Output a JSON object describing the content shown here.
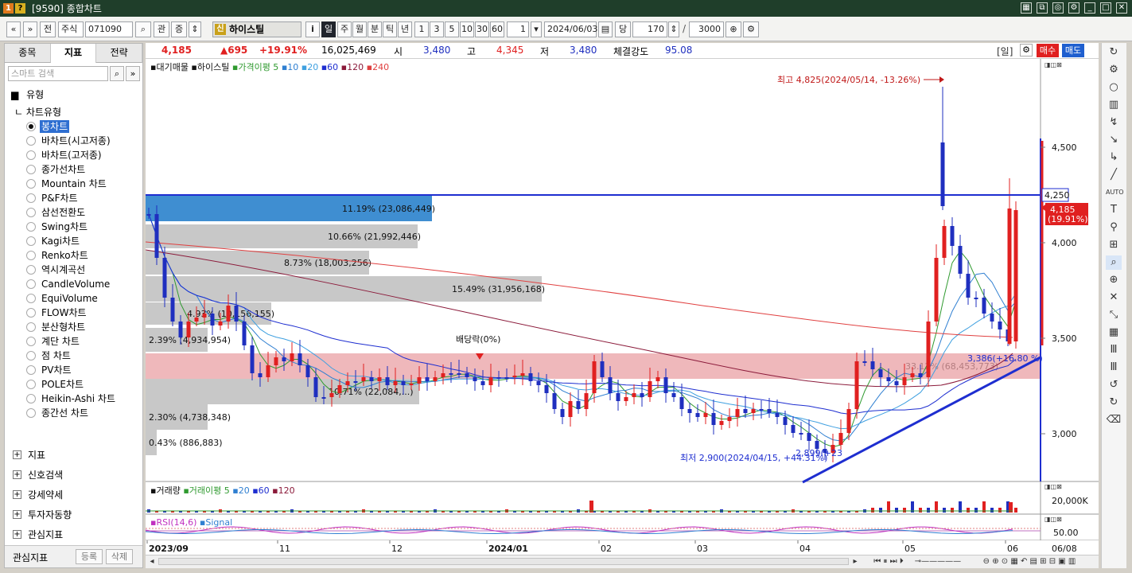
{
  "window": {
    "title": "[9590] 종합차트"
  },
  "toolbar": {
    "nav_prev": "«",
    "nav_down": "»",
    "btn_all": "전",
    "market": "주식",
    "code": "071090",
    "btn_relation": "관",
    "btn_updown": "증",
    "stock_badge": "신",
    "stock_name": "하이스틸",
    "info": "i",
    "periods": [
      "일",
      "주",
      "월",
      "분",
      "틱",
      "년"
    ],
    "active_period": "일",
    "intervals": [
      "1",
      "3",
      "5",
      "10",
      "30",
      "60"
    ],
    "interval_value": "1",
    "date": "2024/06/03",
    "date_unit": "당",
    "count": "170",
    "total": "3000"
  },
  "left_panel": {
    "tabs": [
      "종목",
      "지표",
      "전략"
    ],
    "active_tab": "지표",
    "search_placeholder": "스마트 검색",
    "type_section": "유형",
    "chart_type_header": "차트유형",
    "chart_types": [
      "봉차트",
      "바차트(시고저종)",
      "바차트(고저종)",
      "종가선차트",
      "Mountain 차트",
      "P&F차트",
      "삼선전환도",
      "Swing차트",
      "Kagi차트",
      "Renko차트",
      "역시계곡선",
      "CandleVolume",
      "EquiVolume",
      "FLOW차트",
      "분산형차트",
      "계단 차트",
      "점 차트",
      "PV차트",
      "POLE차트",
      "Heikin-Ashi 차트",
      "종간선 차트"
    ],
    "selected_chart_type": "봉차트",
    "sections": [
      "지표",
      "신호검색",
      "강세약세",
      "투자자동향",
      "관심지표"
    ],
    "footer_label": "관심지표",
    "footer_buttons": [
      "등록",
      "삭제"
    ]
  },
  "quote": {
    "price": "4,185",
    "change": "▲695",
    "change_pct": "+19.91%",
    "volume": "16,025,469",
    "open_label": "시",
    "open": "3,480",
    "high_label": "고",
    "high": "4,345",
    "low_label": "저",
    "low": "3,480",
    "strength_label": "체결강도",
    "strength": "95.08",
    "period_tag": "[일]",
    "buy": "매수",
    "sell": "매도"
  },
  "chart": {
    "legend_main": [
      "대기매물",
      "하이스틸",
      "가격이평",
      "5",
      "10",
      "20",
      "60",
      "120",
      "240"
    ],
    "legend_volume": [
      "거래량",
      "거래이평",
      "5",
      "20",
      "60",
      "120"
    ],
    "legend_rsi": [
      "RSI(14,6)",
      "Signal"
    ],
    "annotation_high": "최고 4,825(2024/05/14, -13.26%)",
    "annotation_low": "최저 2,900(2024/04/15, +44.31%)",
    "annotation_dividend": "배당락(0%)",
    "annotation_low2": "2,899(+23 ",
    "annotation_trend": "3,386(+16.80 %)",
    "annotation_zone": "33.12% (68,453,773)",
    "hline_label": "4,250",
    "price_tag": "4,185",
    "price_tag_pct": "(19.91%)",
    "vol_axis": "20,000K",
    "rsi_axis": "50.00",
    "date_right": "06/08",
    "x_labels": [
      "2023/09",
      "11",
      "12",
      "2024/01",
      "02",
      "03",
      "04",
      "05",
      "06"
    ],
    "y_ticks": [
      "4,500",
      "4,000",
      "3,500",
      "3,000"
    ],
    "volume_profile": [
      {
        "label": "11.19% (23,086,449)"
      },
      {
        "label": "10.66% (21,992,446)"
      },
      {
        "label": "8.73% (18,003,256)"
      },
      {
        "label": "15.49% (31,956,168)"
      },
      {
        "label": "4.93% (10,156,155)"
      },
      {
        "label": "2.39% (4,934,954)"
      },
      {
        "label": "33.12% (68,453,773)"
      },
      {
        "label": "10.71% (22,084,...)"
      },
      {
        "label": "2.30% (4,738,348)"
      },
      {
        "label": "0.43% (886,883)"
      }
    ],
    "colors": {
      "up": "#e02020",
      "down": "#1f2fbf",
      "highlight": "#e9a0a4",
      "profile": "#c8c8c8",
      "profile_top": "#3f8ed1",
      "trend": "#1e2ed0"
    }
  }
}
